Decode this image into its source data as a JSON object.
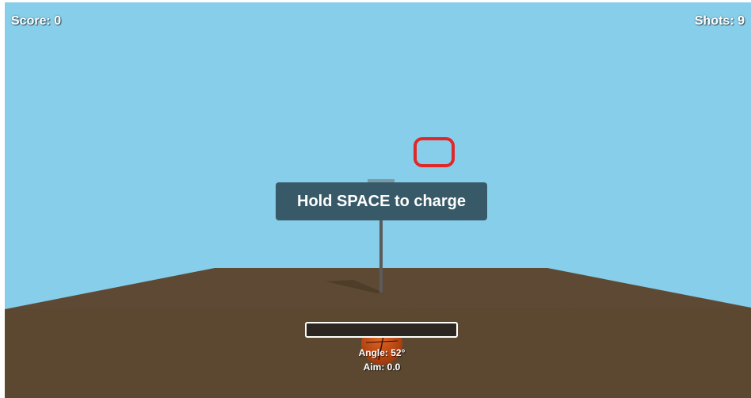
{
  "hud": {
    "score": "Score: 0",
    "shots": "Shots: 9"
  },
  "prompt": "Hold SPACE to charge",
  "power_bar": {
    "charge": 0
  },
  "aim": {
    "angle": "Angle: 52°",
    "aim": "Aim: 0.0"
  },
  "colors": {
    "sky": "#87ceea",
    "ground": "#5e4a34",
    "rim": "#e02828",
    "ball": "#b34412",
    "prompt_bg": "#385a68"
  }
}
